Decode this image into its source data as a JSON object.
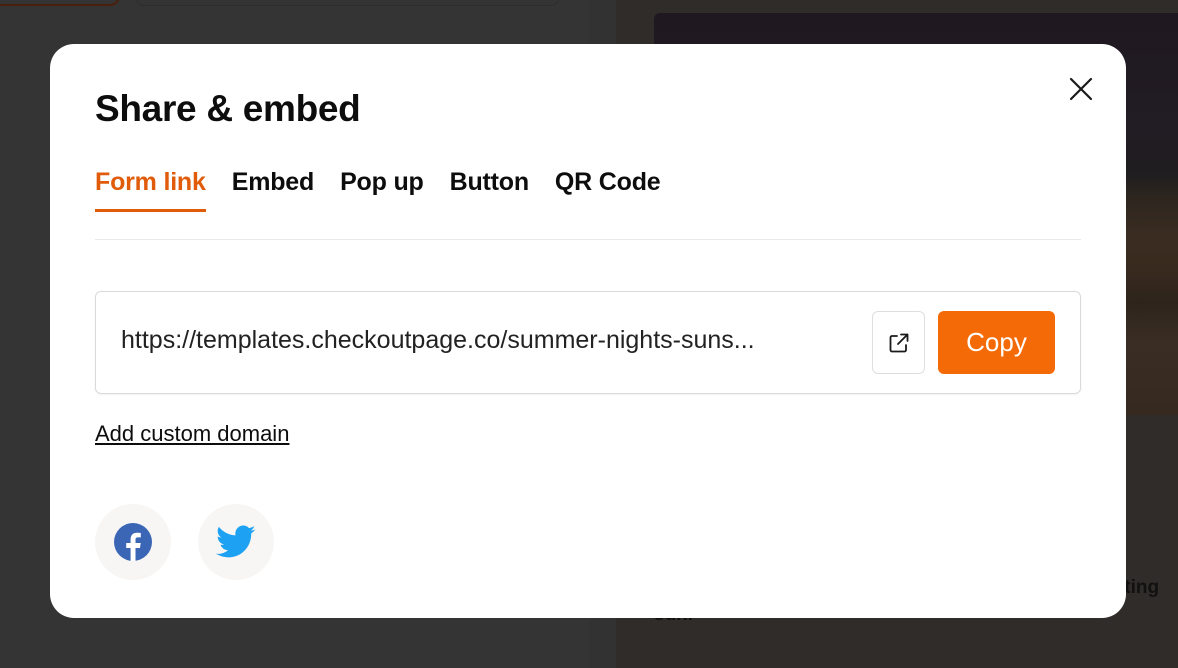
{
  "modal": {
    "title": "Share & embed",
    "close_icon": "close-icon",
    "tabs": [
      {
        "label": "Form link",
        "active": true
      },
      {
        "label": "Embed",
        "active": false
      },
      {
        "label": "Pop up",
        "active": false
      },
      {
        "label": "Button",
        "active": false
      },
      {
        "label": "QR Code",
        "active": false
      }
    ],
    "form_link": {
      "url": "https://templates.checkoutpage.co/summer-nights-suns...",
      "open_icon": "external-link-icon",
      "copy_label": "Copy"
    },
    "custom_domain_label": "Add custom domain",
    "social": [
      {
        "name": "Facebook",
        "icon": "facebook-icon",
        "color": "#3b5998"
      },
      {
        "name": "Twitter",
        "icon": "twitter-icon",
        "color": "#1da1f2"
      }
    ]
  },
  "background": {
    "text_fragment_1": "tting",
    "text_fragment_2": "sun.",
    "text_fragment_3": "",
    "accent_color": "#f46a07"
  }
}
